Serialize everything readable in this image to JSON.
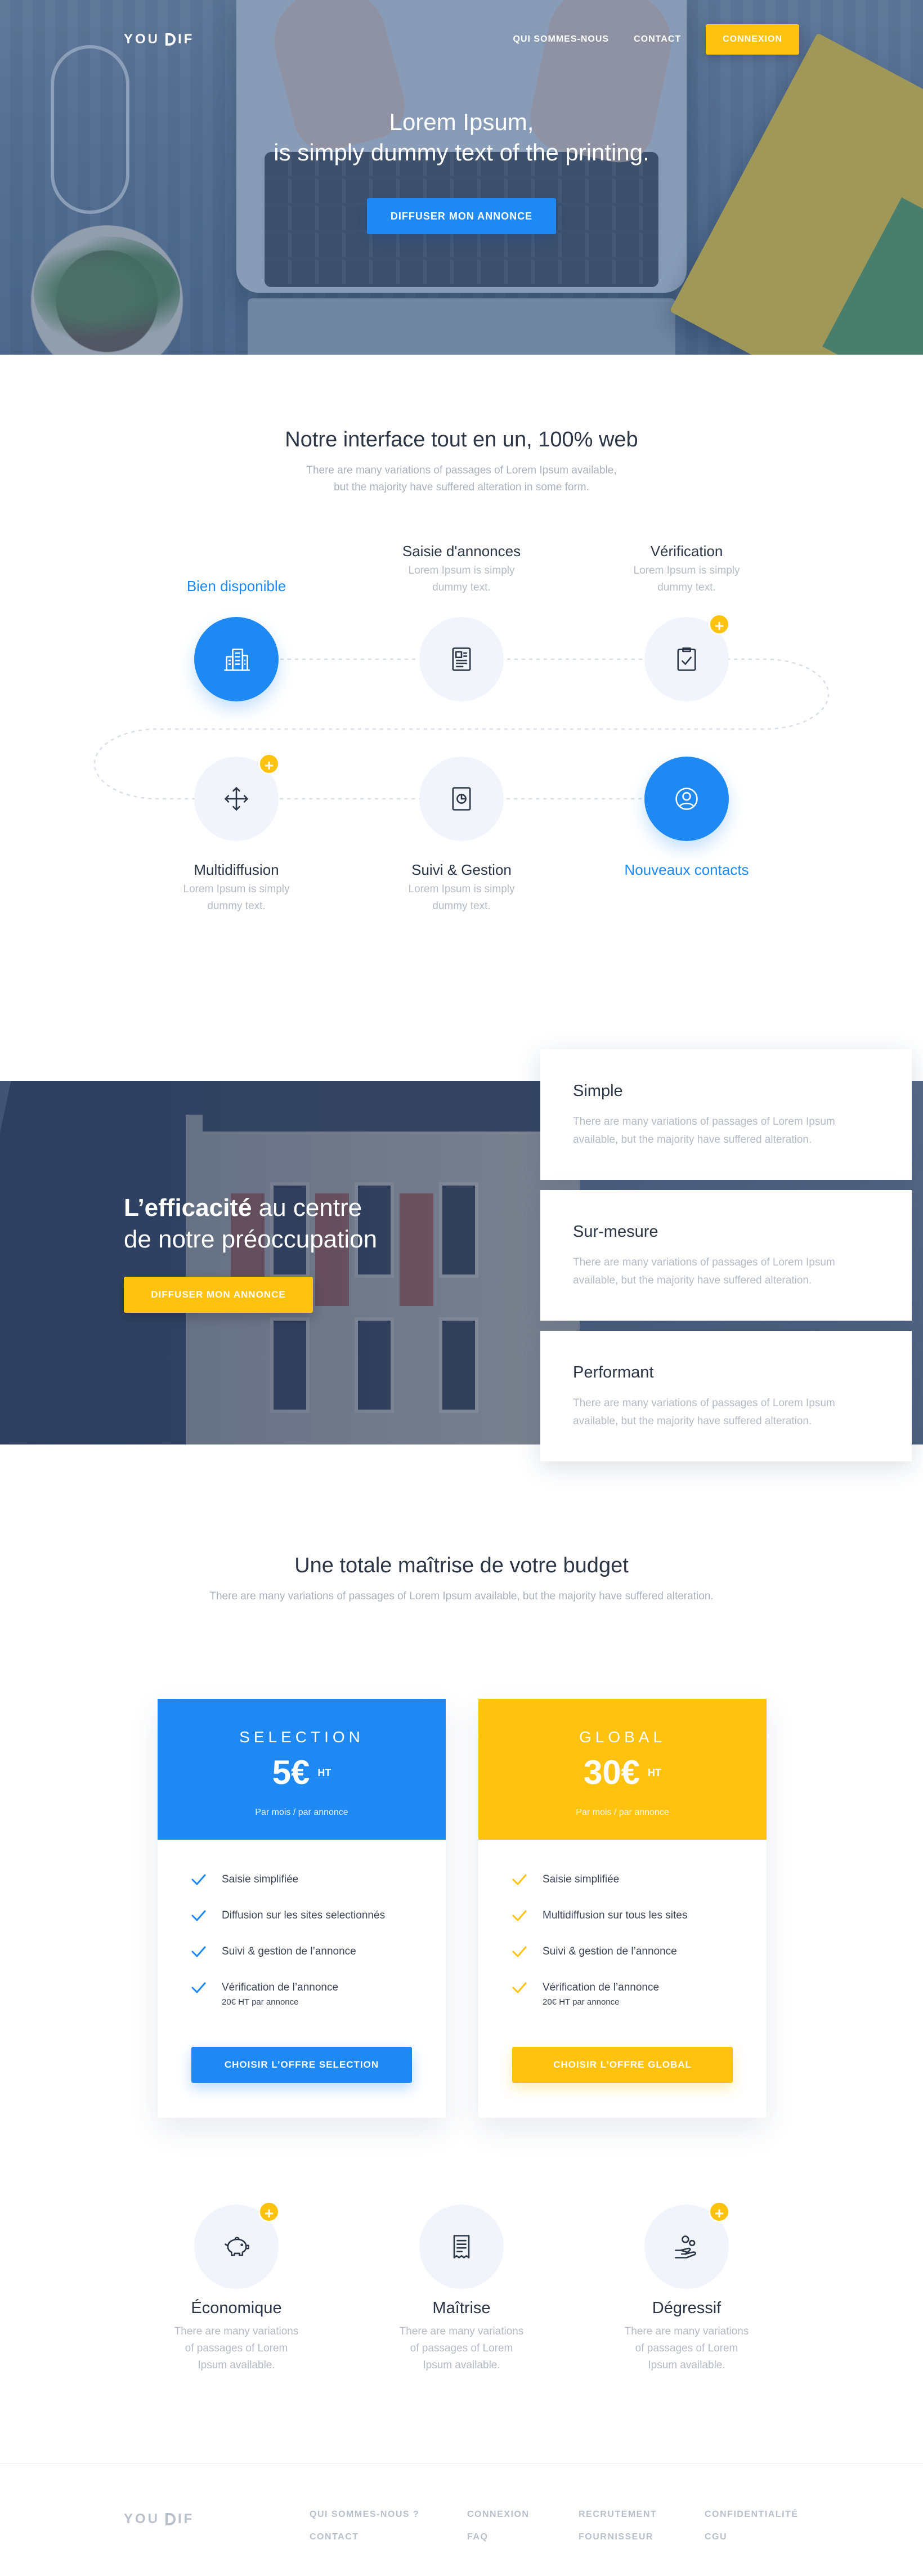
{
  "brand": {
    "logo_text_1": "YOU",
    "logo_text_2": "IF"
  },
  "nav": {
    "links": [
      "QUI SOMMES-NOUS",
      "CONTACT"
    ],
    "login_label": "CONNEXION"
  },
  "hero": {
    "title_line1": "Lorem Ipsum,",
    "title_line2": "is simply dummy text of the printing.",
    "cta_label": "DIFFUSER MON ANNONCE"
  },
  "interface": {
    "title": "Notre interface tout en un, 100% web",
    "subtitle_line1": "There are many variations of passages of Lorem Ipsum available,",
    "subtitle_line2": "but the majority have suffered alteration in some form.",
    "steps": [
      {
        "name": "Bien disponible",
        "desc1": "",
        "desc2": "",
        "icon": "building-icon",
        "highlight": true
      },
      {
        "name": "Saisie d'annonces",
        "desc1": "Lorem Ipsum is simply",
        "desc2": "dummy text.",
        "icon": "document-icon"
      },
      {
        "name": "Vérification",
        "desc1": "Lorem Ipsum is simply",
        "desc2": "dummy text.",
        "icon": "checklist-icon"
      },
      {
        "name": "Multidiffusion",
        "desc1": "Lorem Ipsum is simply",
        "desc2": "dummy text.",
        "icon": "move-arrows-icon"
      },
      {
        "name": "Suivi & Gestion",
        "desc1": "Lorem Ipsum is simply",
        "desc2": "dummy text.",
        "icon": "chart-document-icon"
      },
      {
        "name": "Nouveaux contacts",
        "desc1": "",
        "desc2": "",
        "icon": "user-circle-icon",
        "highlight": true
      }
    ],
    "plus_symbol": "+"
  },
  "efficacite": {
    "title_bold": "L’efficacité",
    "title_rest": " au centre",
    "title_line2": "de notre préoccupation",
    "cta_label": "DIFFUSER MON ANNONCE",
    "cards": [
      {
        "title": "Simple",
        "desc1": "There are many variations of passages of Lorem Ipsum",
        "desc2": "available, but the majority have suffered alteration."
      },
      {
        "title": "Sur-mesure",
        "desc1": "There are many variations of passages of Lorem Ipsum",
        "desc2": "available, but the majority have suffered alteration."
      },
      {
        "title": "Performant",
        "desc1": "There are many variations of passages of Lorem Ipsum",
        "desc2": "available, but the majority have suffered alteration."
      }
    ]
  },
  "pricing": {
    "title": "Une totale maîtrise de votre budget",
    "subtitle": "There are many variations of passages of Lorem Ipsum available, but the majority have suffered alteration.",
    "plans": [
      {
        "name": "SELECTION",
        "price": "5€",
        "ht": "HT",
        "per": "Par mois / par annonce",
        "color": "#1e88f3",
        "features": [
          "Saisie simplifiée",
          "Diffusion sur les sites selectionnés",
          "Suivi & gestion de l’annonce",
          "Vérification de l’annonce"
        ],
        "feature_note": "20€ HT par annonce",
        "cta_label": "CHOISIR L’OFFRE SELECTION"
      },
      {
        "name": "GLOBAL",
        "price": "30€",
        "ht": "HT",
        "per": "Par mois / par annonce",
        "color": "#ffc20e",
        "features": [
          "Saisie simplifiée",
          "Multidiffusion sur tous les sites",
          "Suivi & gestion de l’annonce",
          "Vérification de l’annonce"
        ],
        "feature_note": "20€ HT par annonce",
        "cta_label": "CHOISIR L’OFFRE GLOBAL"
      }
    ]
  },
  "benefits": [
    {
      "name": "Économique",
      "desc1": "There are many variations",
      "desc2": "of passages of Lorem",
      "desc3": "Ipsum available.",
      "icon": "piggy-bank-icon"
    },
    {
      "name": "Maîtrise",
      "desc1": "There are many variations",
      "desc2": "of passages of Lorem",
      "desc3": "Ipsum available.",
      "icon": "receipt-icon"
    },
    {
      "name": "Dégressif",
      "desc1": "There are many variations",
      "desc2": "of passages of Lorem",
      "desc3": "Ipsum available.",
      "icon": "hand-coins-icon"
    }
  ],
  "footer": {
    "columns": [
      [
        "QUI SOMMES-NOUS ?",
        "CONTACT"
      ],
      [
        "CONNEXION",
        "FAQ"
      ],
      [
        "RECRUTEMENT",
        "FOURNISSEUR"
      ],
      [
        "CONFIDENTIALITÉ",
        "CGU"
      ]
    ]
  },
  "colors": {
    "primary": "#1e88f3",
    "accent": "#ffc20e",
    "text": "#2b3546",
    "muted": "#b4bbc6"
  }
}
